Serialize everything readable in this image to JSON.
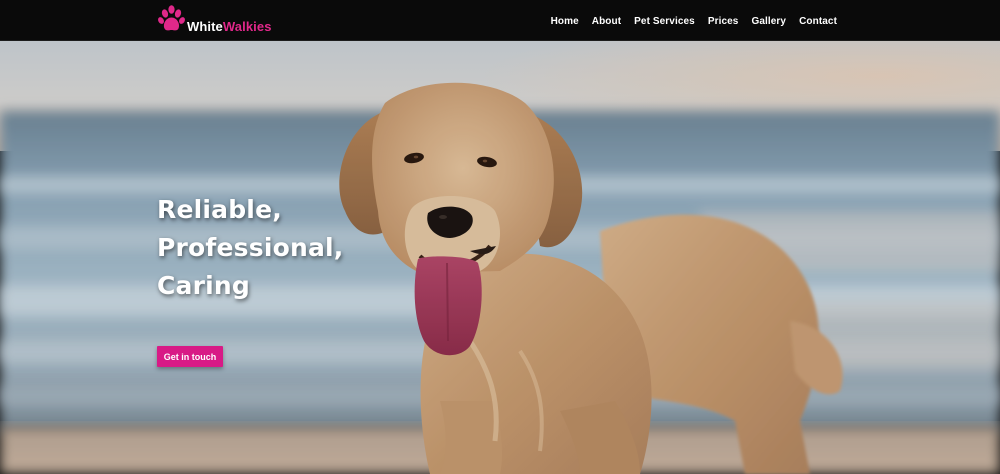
{
  "site": {
    "brand_part1": "White",
    "brand_part2": "Walkies",
    "logo_icon": "paw-icon",
    "accent_color": "#e0288a"
  },
  "nav": {
    "items": [
      {
        "label": "Home"
      },
      {
        "label": "About"
      },
      {
        "label": "Pet Services"
      },
      {
        "label": "Prices"
      },
      {
        "label": "Gallery"
      },
      {
        "label": "Contact"
      }
    ]
  },
  "hero": {
    "headline_lines": [
      "Reliable,",
      "Professional,",
      "Caring"
    ],
    "cta_label": "Get in touch",
    "image_subject": "golden retriever on a beach"
  }
}
